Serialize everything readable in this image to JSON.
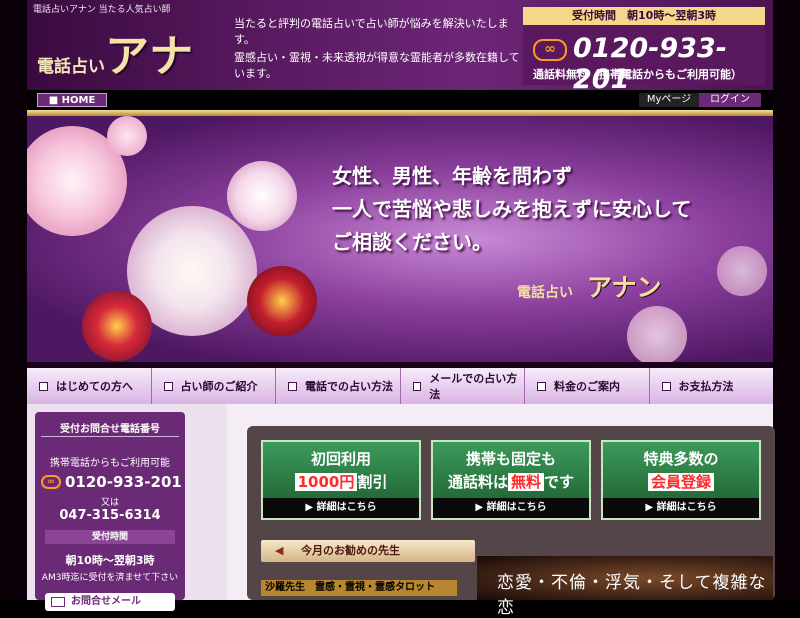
{
  "header": {
    "tagline": "電話占いアナン 当たる人気占い師",
    "logo_small": "電話占い",
    "logo_big": "アナン",
    "desc1": "当たると評判の電話占いで占い師が悩みを解決いたします。",
    "desc2": "霊感占い・霊視・未来透視が得意な霊能者が多数在籍しています。",
    "tel_hours": "受付時間　朝10時～翌朝3時",
    "freedial_icon": "free-dial-icon",
    "freedial_symbol": "∞",
    "tel_number": "0120-933-201",
    "tel_note": "通話料無料（携帯電話からもご利用可能）"
  },
  "topnav": {
    "home": "■ HOME",
    "mypage": "Myページ",
    "login": "ログイン"
  },
  "hero": {
    "line1": "女性、男性、年齢を問わず",
    "line2": "一人で苦悩や悲しみを抱えずに安心して",
    "line3": "ご相談ください。",
    "logo_small": "電話占い",
    "logo_big": "アナン"
  },
  "menu": [
    {
      "label": "はじめての方へ"
    },
    {
      "label": "占い師のご紹介"
    },
    {
      "label": "電話での占い方法"
    },
    {
      "label": "メールでの占い方法"
    },
    {
      "label": "料金のご案内"
    },
    {
      "label": "お支払方法"
    }
  ],
  "sidebar": {
    "title": "受付お問合せ電話番号",
    "mobile_note": "携帯電話からもご利用可能",
    "icon_symbol": "∞",
    "number": "0120-933-201",
    "or": "又は",
    "number2": "047-315-6314",
    "hours_title": "受付時間",
    "hours": "朝10時～翌朝3時",
    "note": "AM3時迄に受付を済ませて下さい",
    "mail": "お問合せメール"
  },
  "promos": [
    {
      "l1": "初回利用",
      "l2_pre": "",
      "l2_hl": "1000円",
      "l2_post": "割引",
      "detail": "▶ 詳細はこちら"
    },
    {
      "l1": "携帯も固定も",
      "l2_pre": "通話料は",
      "l2_hl": "無料",
      "l2_post": "です",
      "detail": "▶ 詳細はこちら"
    },
    {
      "l1": "特典多数の",
      "l2_pre": "",
      "l2_hl": "会員登録",
      "l2_post": "",
      "detail": "▶ 詳細はこちら"
    }
  ],
  "recommend": {
    "head": "今月のお勧めの先生",
    "fortune": "沙羅先生　霊感・霊視・霊感タロット",
    "love": "恋愛・不倫・浮気・そして複雑な恋"
  }
}
